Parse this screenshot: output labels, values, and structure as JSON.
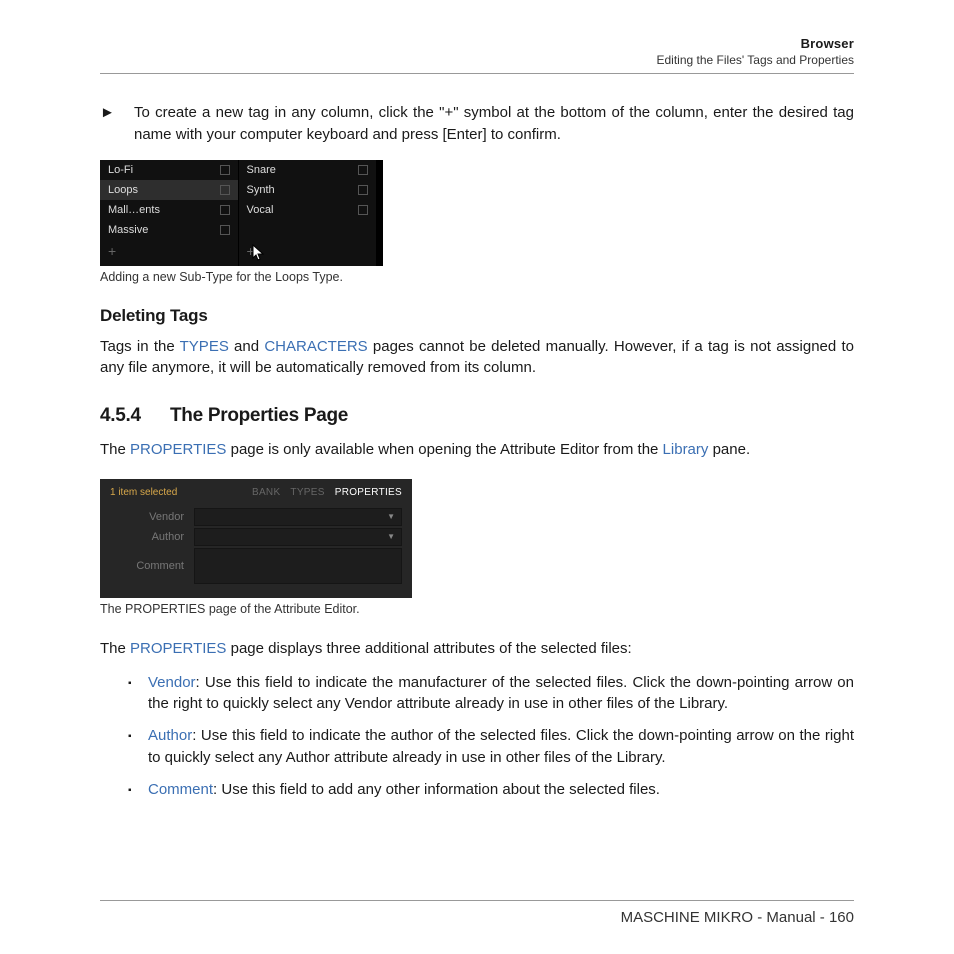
{
  "header": {
    "title": "Browser",
    "subtitle": "Editing the Files' Tags and Properties"
  },
  "instruction": {
    "arrow": "►",
    "text": "To create a new tag in any column, click the \"+\" symbol at the bottom of the column, enter the desired tag name with your computer keyboard and press [Enter] to confirm."
  },
  "fig1": {
    "caption": "Adding a new Sub-Type for the Loops Type.",
    "col1": [
      "Lo-Fi",
      "Loops",
      "Mall…ents",
      "Massive"
    ],
    "col2": [
      "Snare",
      "Synth",
      "Vocal"
    ],
    "plus": "+"
  },
  "deleting": {
    "heading": "Deleting Tags",
    "p_a": "Tags in the ",
    "link1": "TYPES",
    "p_b": " and ",
    "link2": "CHARACTERS",
    "p_c": " pages cannot be deleted manually. However, if a tag is not assigned to any file anymore, it will be automatically removed from its column."
  },
  "section": {
    "num": "4.5.4",
    "title": "The Properties Page",
    "p_a": "The ",
    "link1": "PROPERTIES",
    "p_b": " page is only available when opening the Attribute Editor from the ",
    "link2": "Library",
    "p_c": " pane."
  },
  "fig2": {
    "caption": "The PROPERTIES page of the Attribute Editor.",
    "selected": "1 item selected",
    "tabs": {
      "bank": "BANK",
      "types": "TYPES",
      "properties": "PROPERTIES"
    },
    "rows": {
      "vendor": "Vendor",
      "author": "Author",
      "comment": "Comment"
    },
    "dropdown_glyph": "▼"
  },
  "p3": {
    "a": "The ",
    "link": "PROPERTIES",
    "b": " page displays three additional attributes of the selected files:"
  },
  "bullets": {
    "b1": {
      "term": "Vendor",
      "text": ": Use this field to indicate the manufacturer of the selected files. Click the down-pointing arrow on the right to quickly select any Vendor attribute already in use in other files of the Library."
    },
    "b2": {
      "term": "Author",
      "text": ": Use this field to indicate the author of the selected files. Click the down-pointing arrow on the right to quickly select any Author attribute already in use in other files of the Library."
    },
    "b3": {
      "term": "Comment",
      "text": ": Use this field to add any other information about the selected files."
    }
  },
  "footer": "MASCHINE MIKRO - Manual - 160"
}
